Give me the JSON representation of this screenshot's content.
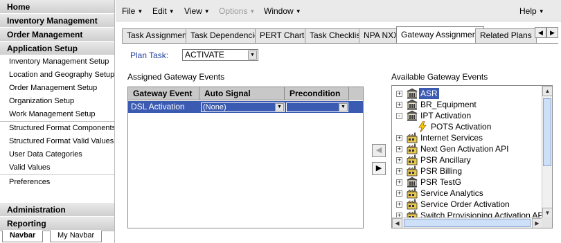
{
  "navbar": {
    "top_headers": [
      "Home",
      "Inventory Management",
      "Order Management",
      "Application Setup"
    ],
    "setup_items_a": [
      "Inventory Management Setup",
      "Location and Geography Setup",
      "Order Management Setup",
      "Organization Setup",
      "Work Management Setup"
    ],
    "setup_items_b": [
      "Structured Format Components",
      "Structured Format Valid Values",
      "User Data Categories",
      "Valid Values"
    ],
    "setup_items_c": [
      "Preferences"
    ],
    "bottom_headers": [
      "Administration",
      "Reporting"
    ],
    "tabs": [
      "Navbar",
      "My Navbar"
    ]
  },
  "menubar": {
    "file": "File",
    "edit": "Edit",
    "view": "View",
    "options": "Options",
    "window": "Window",
    "help": "Help"
  },
  "tabs": [
    "Task Assignment",
    "Task Dependencies",
    "PERT Chart",
    "Task Checklist",
    "NPA NXX",
    "Gateway Assignment",
    "Related Plans"
  ],
  "active_tab": "Gateway Assignment",
  "plan_task": {
    "label": "Plan Task:",
    "value": "ACTIVATE"
  },
  "assigned": {
    "title": "Assigned Gateway Events",
    "columns": [
      "Gateway Event",
      "Auto Signal",
      "Precondition"
    ],
    "rows": [
      {
        "gateway_event": "DSL Activation",
        "auto_signal": "(None)",
        "precondition": ""
      }
    ]
  },
  "available": {
    "title": "Available Gateway Events",
    "items": [
      {
        "label": "ASR",
        "icon": "building-icon",
        "expander": "+",
        "selected": true
      },
      {
        "label": "BR_Equipment",
        "icon": "building-icon",
        "expander": "+"
      },
      {
        "label": "IPT Activation",
        "icon": "building-icon",
        "expander": "-"
      },
      {
        "label": "POTS Activation",
        "icon": "lightning-icon",
        "child": true
      },
      {
        "label": "Internet Services",
        "icon": "factory-icon",
        "expander": "+"
      },
      {
        "label": "Next Gen Activation API",
        "icon": "factory-icon",
        "expander": "+"
      },
      {
        "label": "PSR Ancillary",
        "icon": "factory-icon",
        "expander": "+"
      },
      {
        "label": "PSR Billing",
        "icon": "factory-icon",
        "expander": "+"
      },
      {
        "label": "PSR TestG",
        "icon": "building-icon",
        "expander": "+"
      },
      {
        "label": "Service Analytics",
        "icon": "factory-icon",
        "expander": "+"
      },
      {
        "label": "Service Order Activation",
        "icon": "factory-icon",
        "expander": "+"
      },
      {
        "label": "Switch Provisioning Activation API",
        "icon": "factory-icon",
        "expander": "+"
      }
    ]
  },
  "colors": {
    "selection": "#3b5bb3",
    "label_blue": "#1f3f9f",
    "header_gray": "#c8c8c8"
  }
}
